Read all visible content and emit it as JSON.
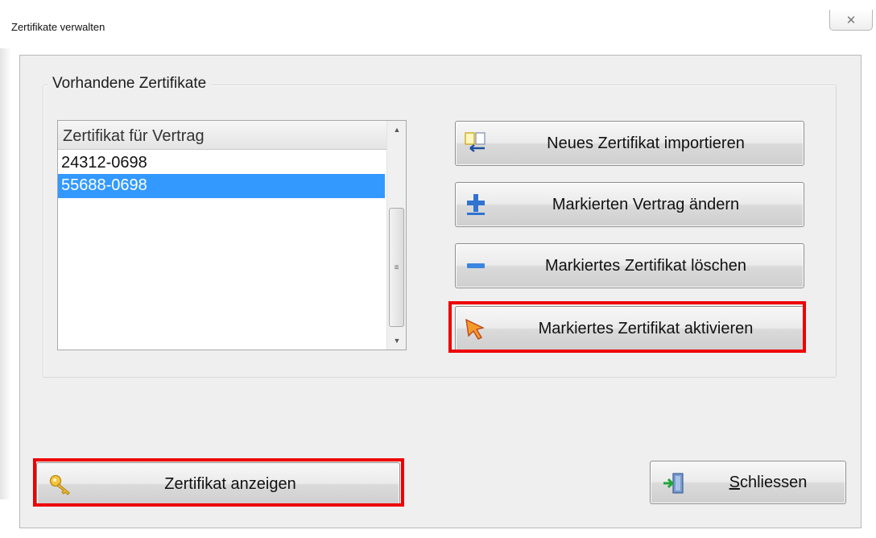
{
  "window": {
    "title": "Zertifikate verwalten",
    "close_glyph": "✕"
  },
  "group": {
    "title": "Vorhandene Zertifikate"
  },
  "list": {
    "header": "Zertifikat für Vertrag",
    "rows": [
      {
        "value": "24312-0698",
        "selected": false
      },
      {
        "value": "55688-0698",
        "selected": true
      }
    ]
  },
  "buttons": {
    "import": {
      "label": "Neues Zertifikat importieren",
      "icon": "import-icon"
    },
    "change": {
      "label": "Markierten Vertrag ändern",
      "icon": "plus-icon"
    },
    "delete": {
      "label": "Markiertes Zertifikat löschen",
      "icon": "minus-icon"
    },
    "activate": {
      "label": "Markiertes Zertifikat aktivieren",
      "icon": "cursor-arrow-icon"
    },
    "show": {
      "label": "Zertifikat anzeigen",
      "icon": "key-icon"
    },
    "close": {
      "label_accel": "S",
      "label_rest": "chliessen",
      "icon": "exit-door-icon"
    }
  },
  "colors": {
    "selection": "#3399ff",
    "highlight": "#ee0000"
  }
}
